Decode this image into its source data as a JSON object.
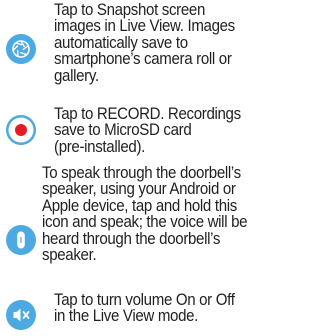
{
  "colors": {
    "icon_fill": "#4ca9e1",
    "record_dot": "#e31b23",
    "icon_white": "#ffffff",
    "text": "#231f20"
  },
  "items": [
    {
      "icon": "camera-aperture-icon",
      "text": "Tap to Snapshot screen\nimages in Live View.  Images\nautomatically save to\nsmartphone’s camera roll or\ngallery."
    },
    {
      "icon": "record-icon",
      "text": "Tap to RECORD. Recordings\nsave to MicroSD card\n(pre-installed)."
    },
    {
      "icon": "microphone-icon",
      "text": "To speak through the doorbell’s\nspeaker, using your Android or\nApple device, tap and hold this\nicon and speak; the voice will be\nheard through the doorbell’s\nspeaker."
    },
    {
      "icon": "speaker-mute-icon",
      "text": "Tap to turn volume On or Off\nin the Live View mode."
    }
  ]
}
